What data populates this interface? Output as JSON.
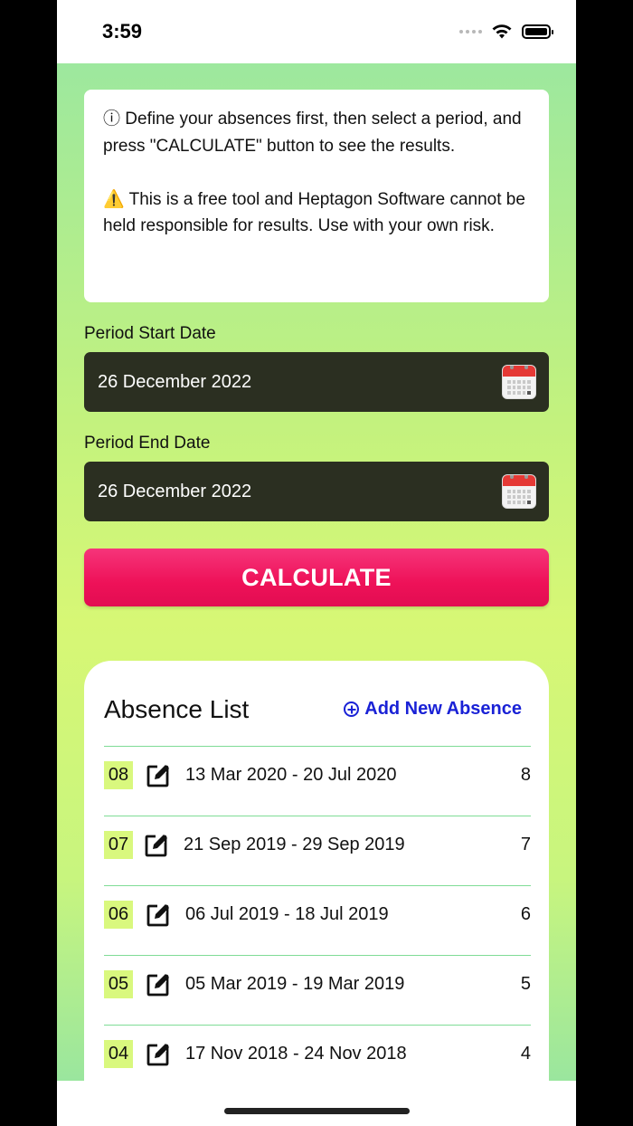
{
  "status_bar": {
    "time": "3:59"
  },
  "info": {
    "line1": "ⓘ Define your absences first, then select a period, and press \"CALCULATE\" button to see the results.",
    "line2": "⚠️ This is a free tool and Heptagon Software cannot be held responsible for results. Use with your own risk."
  },
  "period_start": {
    "label": "Period Start Date",
    "value": "26 December 2022"
  },
  "period_end": {
    "label": "Period End Date",
    "value": "26 December 2022"
  },
  "calculate_label": "CALCULATE",
  "absence_list": {
    "title": "Absence List",
    "add_label": "Add New Absence",
    "items": [
      {
        "num": "08",
        "dates": "13 Mar 2020 - 20 Jul 2020",
        "days": "8"
      },
      {
        "num": "07",
        "dates": "21 Sep 2019 - 29 Sep 2019",
        "days": "7"
      },
      {
        "num": "06",
        "dates": "06 Jul 2019 - 18 Jul 2019",
        "days": "6"
      },
      {
        "num": "05",
        "dates": "05 Mar 2019 - 19 Mar 2019",
        "days": "5"
      },
      {
        "num": "04",
        "dates": "17 Nov 2018 - 24 Nov 2018",
        "days": "4"
      }
    ]
  },
  "colors": {
    "accent": "#ee1158",
    "link": "#1a22d6",
    "field_bg": "#2b2f21",
    "number_highlight": "#d9f87e",
    "divider": "#7fdc96"
  },
  "icons": [
    "wifi-icon",
    "battery-icon",
    "calendar-icon",
    "add-circle-icon",
    "edit-icon"
  ]
}
